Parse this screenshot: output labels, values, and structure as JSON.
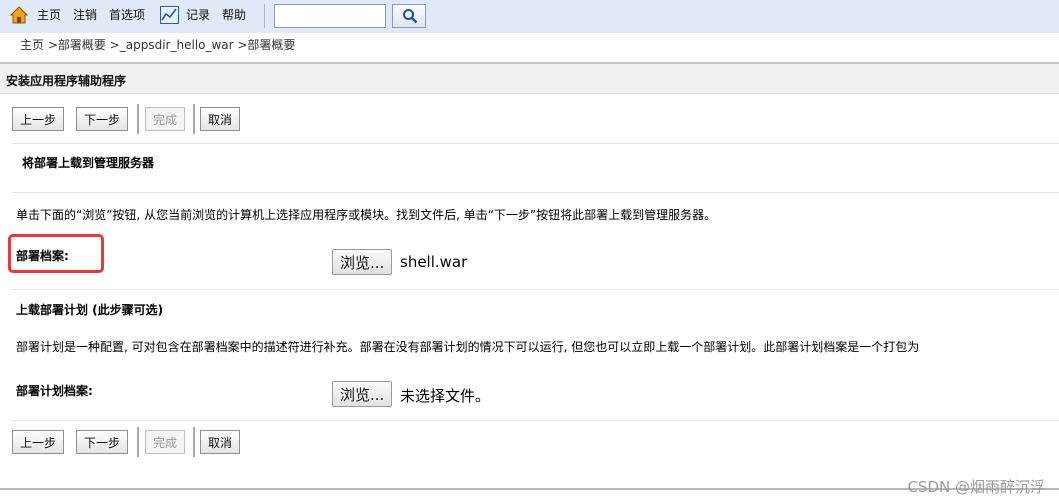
{
  "nav": {
    "home": "主页",
    "logout": "注销",
    "preferences": "首选项",
    "record": "记录",
    "help": "帮助",
    "search_value": ""
  },
  "breadcrumb": "主页 >部署概要 >_appsdir_hello_war >部署概要",
  "section_title": "安装应用程序辅助程序",
  "buttons": {
    "prev": "上一步",
    "next": "下一步",
    "finish": "完成",
    "cancel": "取消"
  },
  "upload": {
    "heading": "将部署上载到管理服务器",
    "description": "单击下面的“浏览”按钮, 从您当前浏览的计算机上选择应用程序或模块。找到文件后, 单击“下一步”按钮将此部署上载到管理服务器。",
    "archive_label": "部署档案:",
    "browse_label": "浏览...",
    "archive_file": "shell.war"
  },
  "plan": {
    "heading": "上载部署计划 (此步骤可选)",
    "description": "部署计划是一种配置, 可对包含在部署档案中的描述符进行补充。部署在没有部署计划的情况下可以运行, 但您也可以立即上载一个部署计划。此部署计划档案是一个打包为",
    "archive_label": "部署计划档案:",
    "browse_label": "浏览...",
    "no_file": "未选择文件。"
  },
  "watermark": "CSDN @烟雨醉沉浮",
  "colors": {
    "topbar_bg": "#dfe9f7",
    "highlight_box": "#e33a3a"
  },
  "icons": {
    "home": "home-icon",
    "record": "chart-icon",
    "search": "search-icon"
  }
}
